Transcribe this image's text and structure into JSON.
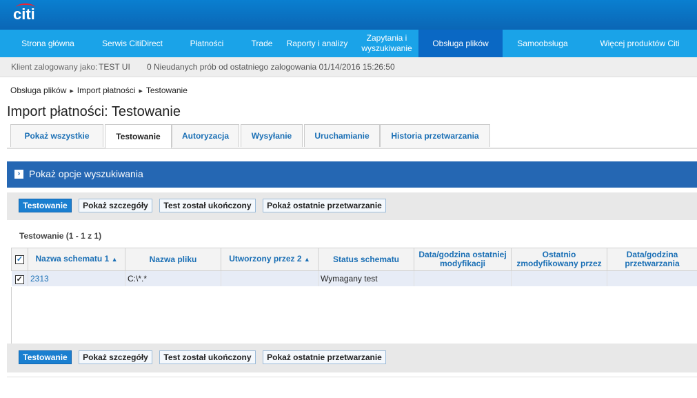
{
  "brand": {
    "logo": "citi"
  },
  "nav": [
    {
      "label": "Strona główna",
      "width": 139
    },
    {
      "label": "Serwis CitiDirect",
      "width": 106
    },
    {
      "label": "Płatności",
      "width": 110
    },
    {
      "label": "Trade",
      "width": 50
    },
    {
      "label": "Raporty i analizy",
      "width": 110
    },
    {
      "label": "Zapytania i wyszukiwanie",
      "width": 92
    },
    {
      "label": "Obsługa plików",
      "width": 122
    },
    {
      "label": "Samoobsługa",
      "width": 116
    },
    {
      "label": "Więcej produktów Citi",
      "width": 166
    }
  ],
  "nav_active_index": 6,
  "info": {
    "user_label": "Klient zalogowany jako:",
    "user": "TEST UI",
    "failed": "0 Nieudanych prób od ostatniego zalogowania 01/14/2016 15:26:50"
  },
  "breadcrumb": [
    "Obsługa plików",
    "Import płatności",
    "Testowanie"
  ],
  "title": "Import płatności: Testowanie",
  "tabs": [
    "Pokaż wszystkie",
    "Testowanie",
    "Autoryzacja",
    "Wysyłanie",
    "Uruchamianie",
    "Historia przetwarzania"
  ],
  "tabs_active_index": 1,
  "search_toggle": "Pokaż opcje wyszukiwania",
  "actions": {
    "test": "Testowanie",
    "details": "Pokaż szczegóły",
    "done": "Test został ukończony",
    "recent": "Pokaż ostatnie przetwarzanie"
  },
  "results_label": "Testowanie (1 - 1 z 1)",
  "table": {
    "columns": [
      "",
      "Nazwa schematu 1",
      "Nazwa pliku",
      "Utworzony przez 2",
      "Status schematu",
      "Data/godzina ostatniej modyfikacji",
      "Ostatnio zmodyfikowany przez",
      "Data/godzina przetwarzania"
    ],
    "rows": [
      {
        "checked": true,
        "schema": "2313",
        "file": "C:\\*.*",
        "created_by": "",
        "status": "Wymagany test",
        "modified": "",
        "modified_by": "",
        "processed": ""
      }
    ]
  },
  "colors": {
    "nav": "#1aa3e8",
    "nav_active": "#0a68c4",
    "topbar": "#0b72c4",
    "search": "#2567b3",
    "primary_button": "#1a7fd0"
  }
}
